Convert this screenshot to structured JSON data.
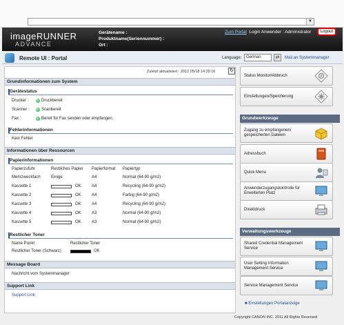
{
  "browser": {
    "address_value": ""
  },
  "header": {
    "logo_line1": "imageRUNNER",
    "logo_line2": "ADVANCE",
    "device_name_label": "Gerätename :",
    "product_label": "Produktname(Seriennummer) :",
    "location_label": "Ort :",
    "zum_portal": "Zum Portal",
    "login_text": "Login Anwender : Administrator",
    "logout": "Logout"
  },
  "portal": {
    "title": "Remote UI : Portal",
    "language_label": "Language:",
    "language_value": "German",
    "mail_link": "Mail an Systemmanager"
  },
  "main": {
    "updated": "Zuletzt aktualisiert : 2012 05/18 14:29:16",
    "basic_info_header": "Grundinformationen zum System",
    "device_status_header": "Gerätestatus",
    "status": [
      {
        "label": "Drucker :",
        "value": "Druckbereit"
      },
      {
        "label": "Scanner :",
        "value": "Scanbereit"
      },
      {
        "label": "Fax :",
        "value": "Bereit für Fax senden oder empfangen."
      }
    ],
    "error_header": "Fehlerinformationen",
    "error_value": "Kein Fehler",
    "resources_header": "Informationen über Ressourcen",
    "paper_header": "Papierinformationen",
    "paper_columns": [
      "Papierzufuhr",
      "Restliches Papier",
      "Papierformat",
      "Papiertyp"
    ],
    "paper_rows": [
      {
        "source": "Mehrzweckfach",
        "remaining": "Einige",
        "format": "A4",
        "type": "Normal (64-90 g/m2)"
      },
      {
        "source": "Kassette 1",
        "remaining": "OK",
        "format": "A4",
        "type": "Recycling (64-90 g/m2)"
      },
      {
        "source": "Kassette 2",
        "remaining": "OK",
        "format": "A4",
        "type": "Farbig (64-90 g/m2)"
      },
      {
        "source": "Kassette 3",
        "remaining": "OK",
        "format": "A4",
        "type": "Recycling (64-90 g/m2)"
      },
      {
        "source": "Kassette 4",
        "remaining": "OK",
        "format": "A3",
        "type": "Normal (64-90 g/m2)"
      },
      {
        "source": "Kassette 5",
        "remaining": "OK",
        "format": "A3",
        "type": "Normal (64-90 g/m2)"
      }
    ],
    "toner_header": "Restlicher Toner",
    "toner_columns": [
      "Name Punkt",
      "Restlicher Toner"
    ],
    "toner_rows": [
      {
        "name": "Restlicher Toner (Schwarz)",
        "value": "OK"
      }
    ],
    "message_header": "Message Board",
    "message_value": "Nachricht vom Systemmanager",
    "support_header": "Support Link",
    "support_value": "Support Link"
  },
  "right": {
    "status_monitor": "Status Monitor/Abbruch",
    "settings_registration": "Einstellungen/Speicherung",
    "basic_tools_header": "Grundwerkzeuge",
    "tools": [
      "Zugang zu empfangenen/ gespeicherten Dateien",
      "Adressbuch",
      "Quick Menu",
      "Anwenderzugangskontrolle für Erweiterten Platz",
      "Direktdruck"
    ],
    "admin_tools_header": "Verwaltungswerkzeuge",
    "admin_tools": [
      "Shared Credential Management Service",
      "User Setting Information Management Service",
      "Service Management Service"
    ],
    "portal_settings_link": "Einstellungen Portalanzeige"
  },
  "footer": {
    "copyright": "Copyright CANON INC. 2011 All Rights Reserved"
  }
}
